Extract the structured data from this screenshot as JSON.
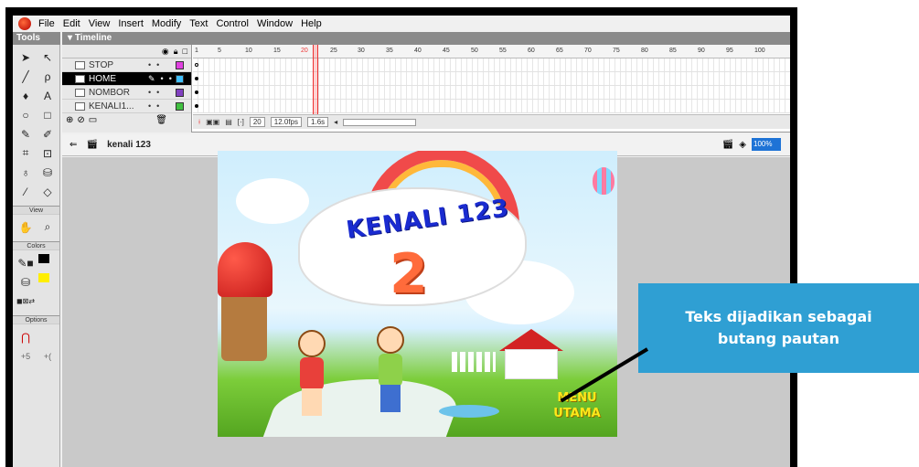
{
  "menubar": {
    "items": [
      "File",
      "Edit",
      "View",
      "Insert",
      "Modify",
      "Text",
      "Control",
      "Window",
      "Help"
    ]
  },
  "tools": {
    "title": "Tools",
    "sections": [
      "View",
      "Colors",
      "Options"
    ]
  },
  "timeline": {
    "title": "Timeline",
    "ruler_ticks": [
      "1",
      "5",
      "10",
      "15",
      "20",
      "25",
      "30",
      "35",
      "40",
      "45",
      "50",
      "55",
      "60",
      "65",
      "70",
      "75",
      "80",
      "85",
      "90",
      "95",
      "100"
    ],
    "layers": [
      {
        "name": "STOP",
        "color": "#e040e0"
      },
      {
        "name": "HOME",
        "color": "#40c0ff"
      },
      {
        "name": "NOMBOR",
        "color": "#8040c0"
      },
      {
        "name": "KENALI1...",
        "color": "#40c040"
      }
    ],
    "status": {
      "frame": "20",
      "fps": "12.0fps",
      "time": "1.6s"
    }
  },
  "editbar": {
    "scene": "kenali 123",
    "zoom": "100%"
  },
  "stage": {
    "game_title": "KENALI 123",
    "big_number": "2",
    "menu_button": "MENU\nUTAMA"
  },
  "callout": {
    "text": "Teks dijadikan sebagai\nbutang pautan",
    "color": "#2f9fd3"
  }
}
